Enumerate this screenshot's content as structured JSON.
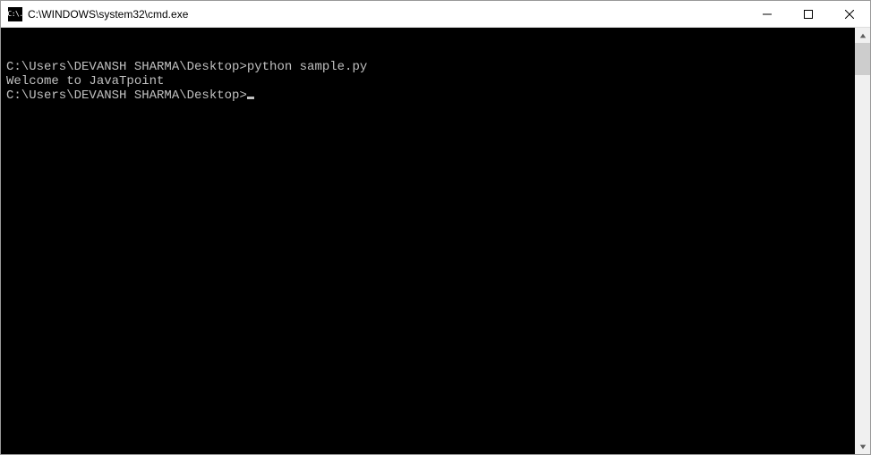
{
  "window": {
    "title": "C:\\WINDOWS\\system32\\cmd.exe",
    "icon_text": "C:\\."
  },
  "terminal": {
    "lines": [
      {
        "prompt": "C:\\Users\\DEVANSH SHARMA\\Desktop>",
        "command": "python sample.py"
      },
      {
        "output": "Welcome to JavaTpoint"
      },
      {
        "output": ""
      },
      {
        "prompt": "C:\\Users\\DEVANSH SHARMA\\Desktop>",
        "command": "",
        "cursor": true
      }
    ]
  }
}
